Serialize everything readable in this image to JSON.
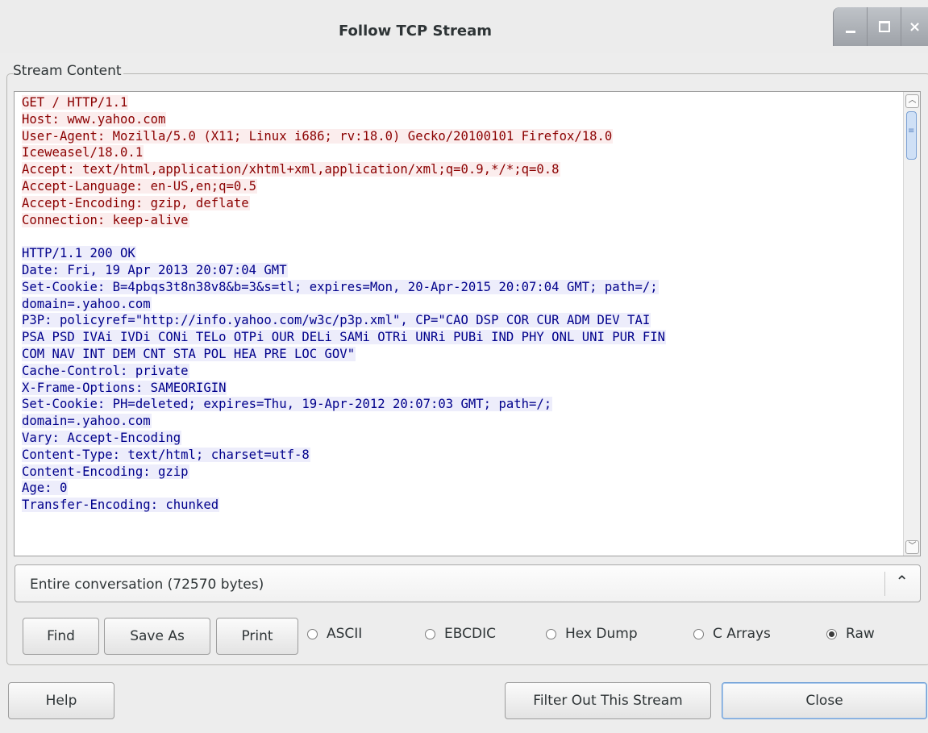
{
  "window": {
    "title": "Follow TCP Stream",
    "controls": {
      "minimize_icon": "minimize-icon",
      "maximize_icon": "maximize-icon",
      "close_icon": "close-icon",
      "close_glyph": "×"
    }
  },
  "stream_content": {
    "label": "Stream Content",
    "request_lines": [
      "GET / HTTP/1.1",
      "Host: www.yahoo.com",
      "User-Agent: Mozilla/5.0 (X11; Linux i686; rv:18.0) Gecko/20100101 Firefox/18.0",
      "Iceweasel/18.0.1",
      "Accept: text/html,application/xhtml+xml,application/xml;q=0.9,*/*;q=0.8",
      "Accept-Language: en-US,en;q=0.5",
      "Accept-Encoding: gzip, deflate",
      "Connection: keep-alive"
    ],
    "response_lines": [
      "HTTP/1.1 200 OK",
      "Date: Fri, 19 Apr 2013 20:07:04 GMT",
      "Set-Cookie: B=4pbqs3t8n38v8&b=3&s=tl; expires=Mon, 20-Apr-2015 20:07:04 GMT; path=/;",
      "domain=.yahoo.com",
      "P3P: policyref=\"http://info.yahoo.com/w3c/p3p.xml\", CP=\"CAO DSP COR CUR ADM DEV TAI",
      "PSA PSD IVAi IVDi CONi TELo OTPi OUR DELi SAMi OTRi UNRi PUBi IND PHY ONL UNI PUR FIN",
      "COM NAV INT DEM CNT STA POL HEA PRE LOC GOV\"",
      "Cache-Control: private",
      "X-Frame-Options: SAMEORIGIN",
      "Set-Cookie: PH=deleted; expires=Thu, 19-Apr-2012 20:07:03 GMT; path=/;",
      "domain=.yahoo.com",
      "Vary: Accept-Encoding",
      "Content-Type: text/html; charset=utf-8",
      "Content-Encoding: gzip",
      "Age: 0",
      "Transfer-Encoding: chunked"
    ],
    "colors": {
      "request_text": "#8b0000",
      "request_bg": "#fbeded",
      "response_text": "#00008b",
      "response_bg": "#ededfb"
    }
  },
  "conversation_select": {
    "selected": "Entire conversation (72570 bytes)"
  },
  "actions": {
    "find": "Find",
    "save_as": "Save As",
    "print": "Print"
  },
  "formats": {
    "options": [
      "ASCII",
      "EBCDIC",
      "Hex Dump",
      "C Arrays",
      "Raw"
    ],
    "selected": "Raw"
  },
  "footer": {
    "help": "Help",
    "filter_out": "Filter Out This Stream",
    "close": "Close"
  }
}
